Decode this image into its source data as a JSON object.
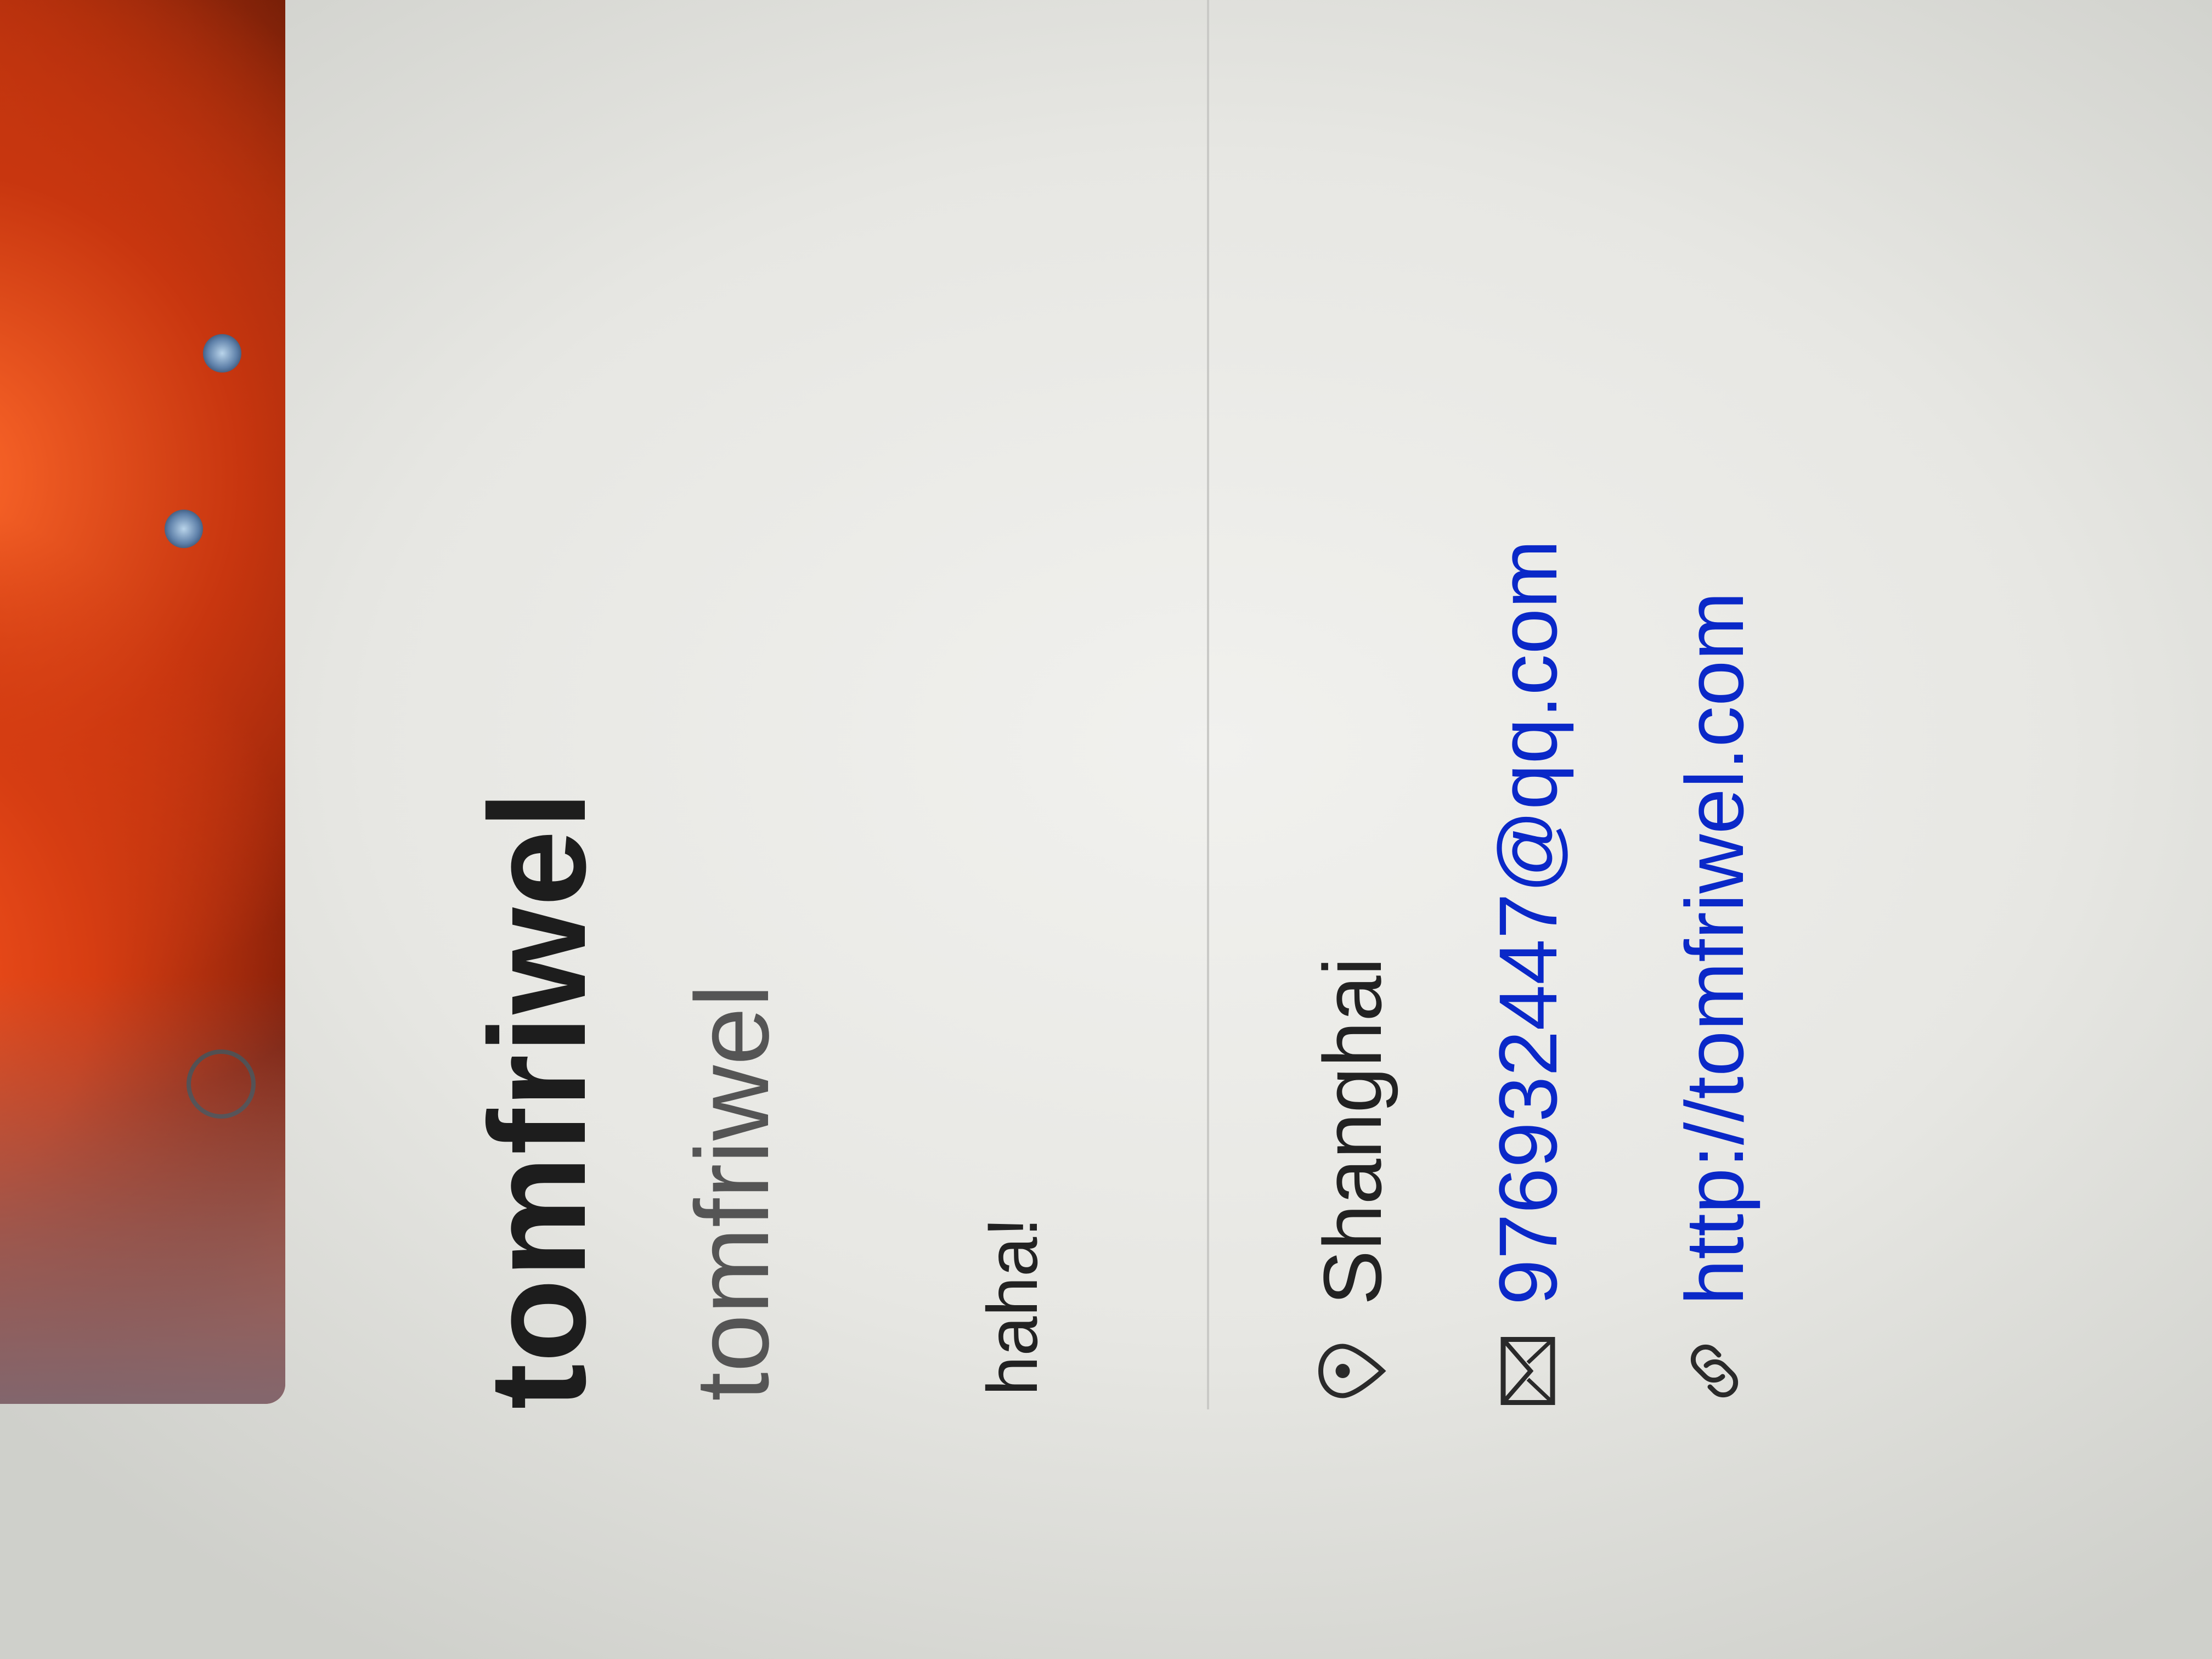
{
  "profile": {
    "display_name": "tomfriwel",
    "username": "tomfriwel",
    "bio": "haha!"
  },
  "details": {
    "location": {
      "icon": "location-pin-icon",
      "text": "Shanghai"
    },
    "email": {
      "icon": "mail-icon",
      "text": "976932447@qq.com"
    },
    "website": {
      "icon": "link-icon",
      "text": "http://tomfriwel.com"
    }
  },
  "colors": {
    "link": "#0a28c8",
    "name": "#1d1d1d",
    "secondary": "#555555",
    "avatar_accent": "#d63d12"
  }
}
